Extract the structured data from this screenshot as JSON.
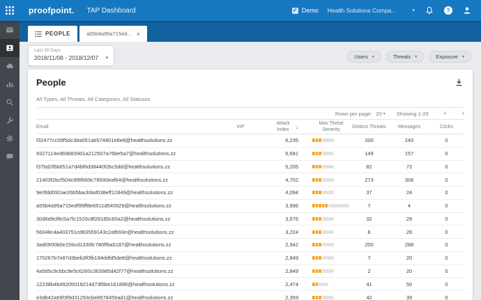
{
  "colors": {
    "header_blue": "#1778c2",
    "tabstrip_blue": "#11619e",
    "sidebar_gray": "#42464d",
    "severity_orange": "#f5a623",
    "page_bg": "#e9ebee"
  },
  "glyphs": {
    "caret": "▾",
    "close": "×",
    "prev": "‹",
    "next": "›",
    "sort_desc": "↓",
    "help": "?",
    "check": "✓"
  },
  "header": {
    "logo": "proofpoint.",
    "app_title": "TAP Dashboard",
    "demo_label": "Demo",
    "company": "Health Solutions Compa..."
  },
  "tabs": {
    "people": {
      "label": "PEOPLE"
    },
    "detail": {
      "label": "a55b4a95a715ed..."
    }
  },
  "filters": {
    "date": {
      "label": "Last 30 Days",
      "value": "2018/11/08 - 2018/12/07"
    },
    "pills": [
      {
        "label": "Users"
      },
      {
        "label": "Threats"
      },
      {
        "label": "Exposure"
      }
    ]
  },
  "panel": {
    "title": "People",
    "subtitle": "All Types, All Threats, All Categories, All Statuses",
    "pagination": {
      "rows_per_page_label": "Rows per page:",
      "page_size": "20",
      "showing": "Showing 1-20"
    }
  },
  "table": {
    "headers": {
      "email": "Email",
      "vip": "VIP",
      "attack_index": "Attack Index",
      "severity": "Max Threat Severity",
      "distinct_threats": "Distinct Threats",
      "messages": "Messages",
      "clicks": "Clicks"
    },
    "sort": {
      "column": "attack_index",
      "direction": "desc"
    },
    "rows": [
      {
        "email": "f32477cc09f5dc38a051ab574801e8e8@healthsolutions.zz",
        "vip": "",
        "attack_index": "6,235",
        "severity_segments": 3,
        "distinct_threats": 200,
        "messages": 240,
        "clicks": 0
      },
      {
        "email": "9327114ed69b839d1a212507a76be5a7@healthsolutions.zz",
        "vip": "",
        "attack_index": "5,681",
        "severity_segments": 3,
        "distinct_threats": 149,
        "messages": 157,
        "clicks": 0
      },
      {
        "email": "f37bd2f6b651a7d4bf6d38440f2bc5dd@healthsolutions.zz",
        "vip": "",
        "attack_index": "5,205",
        "severity_segments": 3,
        "distinct_threats": 82,
        "messages": 72,
        "clicks": 0
      },
      {
        "email": "21403f2bcf504c6f6f669c78930eaf64@healthsolutions.zz",
        "vip": "",
        "attack_index": "4,702",
        "severity_segments": 3,
        "distinct_threats": 273,
        "messages": 306,
        "clicks": 0
      },
      {
        "email": "9e0fdd092ae26b5bacb9af038eff12849@healthsolutions.zz",
        "vip": "",
        "attack_index": "4,094",
        "severity_segments": 3,
        "distinct_threats": 37,
        "messages": 24,
        "clicks": 0
      },
      {
        "email": "a55b4a95a715edf95ff8e6511d540929@healthsolutions.zz",
        "vip": "",
        "attack_index": "3,996",
        "severity_segments": 5,
        "distinct_threats": 7,
        "messages": 4,
        "clicks": 0
      },
      {
        "email": "30d6d9cf8c5a7fc1520c8f28185c60a2@healthsolutions.zz",
        "vip": "",
        "attack_index": "3,576",
        "severity_segments": 3,
        "distinct_threats": 32,
        "messages": 29,
        "clicks": 0
      },
      {
        "email": "56048c4a403751cd83559143c2afb93e@healthsolutions.zz",
        "vip": "",
        "attack_index": "3,224",
        "severity_segments": 3,
        "distinct_threats": 8,
        "messages": 26,
        "clicks": 0
      },
      {
        "email": "3ad0900b0e159cd1330fc780ff6a5187@healthsolutions.zz",
        "vip": "",
        "attack_index": "2,942",
        "severity_segments": 3,
        "distinct_threats": 200,
        "messages": 288,
        "clicks": 0
      },
      {
        "email": "170267b7e87d3beb3f0fb184ddfd5de8@healthsolutions.zz",
        "vip": "",
        "attack_index": "2,849",
        "severity_segments": 3,
        "distinct_threats": 7,
        "messages": 20,
        "clicks": 0
      },
      {
        "email": "4a5d5c9cbbc9e5c6260c363985d42f77@healthsolutions.zz",
        "vip": "",
        "attack_index": "2,849",
        "severity_segments": 3,
        "distinct_threats": 2,
        "messages": 20,
        "clicks": 0
      },
      {
        "email": "12238b4b49205018214d73f6be161896@healthsolutions.zz",
        "vip": "",
        "attack_index": "2,474",
        "severity_segments": 2,
        "distinct_threats": 41,
        "messages": 50,
        "clicks": 0
      },
      {
        "email": "e3db42a69f3f9d31293cbe8578456ad1@healthsolutions.zz",
        "vip": "",
        "attack_index": "2,359",
        "severity_segments": 3,
        "distinct_threats": 42,
        "messages": 39,
        "clicks": 0
      }
    ]
  },
  "sidebar": {
    "active": "people"
  }
}
